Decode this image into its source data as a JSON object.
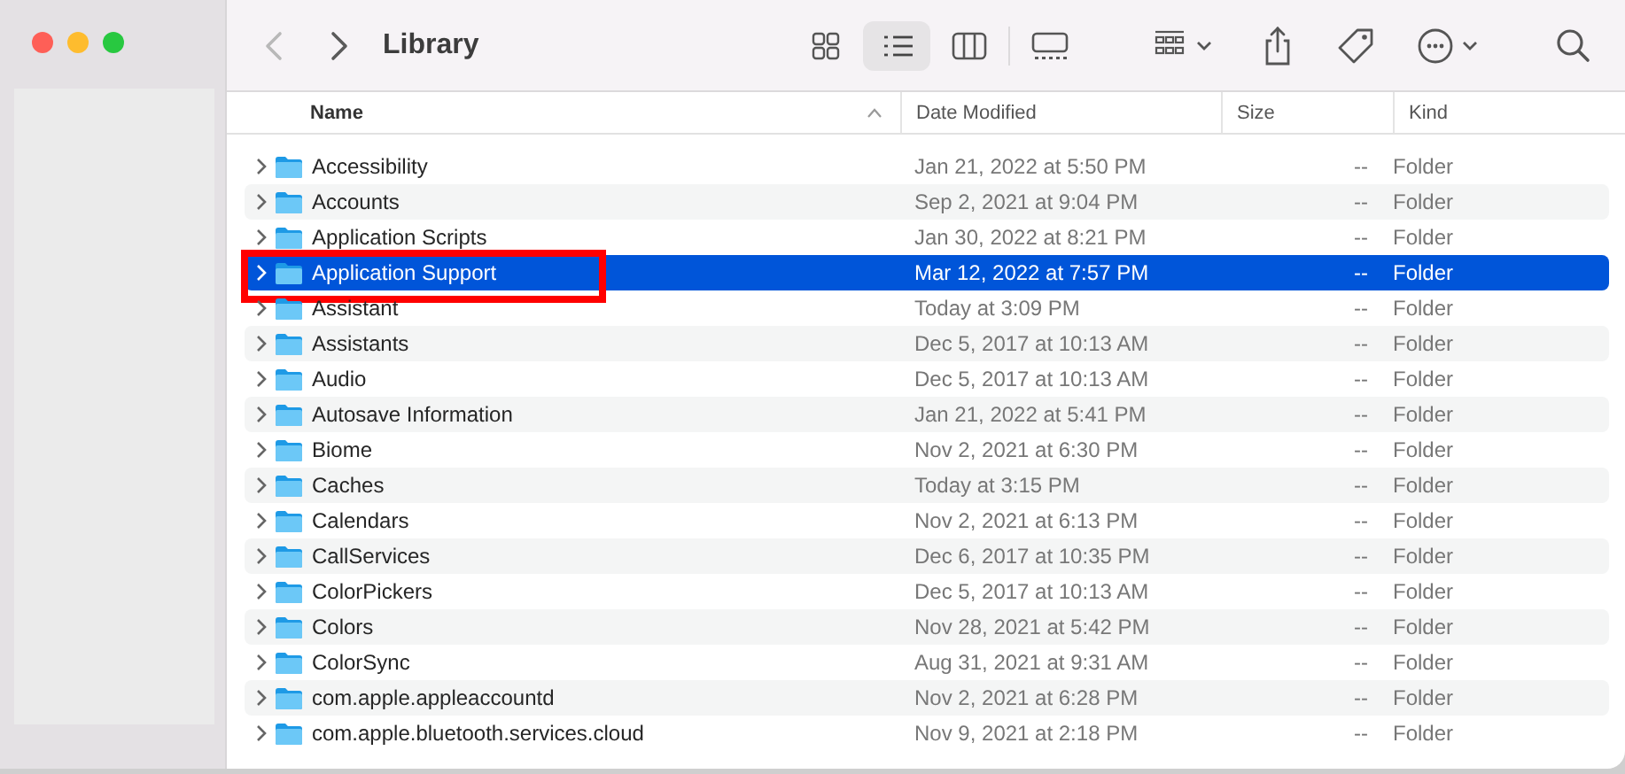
{
  "window": {
    "title": "Library"
  },
  "navigation": {
    "back_disabled": true,
    "forward_disabled": false
  },
  "views": [
    {
      "kind": "icons",
      "selected": false
    },
    {
      "kind": "list",
      "selected": true
    },
    {
      "kind": "columns",
      "selected": false
    },
    {
      "kind": "gallery",
      "selected": false
    }
  ],
  "columns": [
    {
      "label": "Name",
      "sorted": true
    },
    {
      "label": "Date Modified",
      "sorted": false
    },
    {
      "label": "Size",
      "sorted": false
    },
    {
      "label": "Kind",
      "sorted": false
    }
  ],
  "rows": [
    {
      "name": "Accessibility",
      "date": "Jan 21, 2022 at 5:50 PM",
      "size": "--",
      "kind": "Folder",
      "selected": false
    },
    {
      "name": "Accounts",
      "date": "Sep 2, 2021 at 9:04 PM",
      "size": "--",
      "kind": "Folder",
      "selected": false
    },
    {
      "name": "Application Scripts",
      "date": "Jan 30, 2022 at 8:21 PM",
      "size": "--",
      "kind": "Folder",
      "selected": false
    },
    {
      "name": "Application Support",
      "date": "Mar 12, 2022 at 7:57 PM",
      "size": "--",
      "kind": "Folder",
      "selected": true,
      "highlighted": true
    },
    {
      "name": "Assistant",
      "date": "Today at 3:09 PM",
      "size": "--",
      "kind": "Folder",
      "selected": false
    },
    {
      "name": "Assistants",
      "date": "Dec 5, 2017 at 10:13 AM",
      "size": "--",
      "kind": "Folder",
      "selected": false
    },
    {
      "name": "Audio",
      "date": "Dec 5, 2017 at 10:13 AM",
      "size": "--",
      "kind": "Folder",
      "selected": false
    },
    {
      "name": "Autosave Information",
      "date": "Jan 21, 2022 at 5:41 PM",
      "size": "--",
      "kind": "Folder",
      "selected": false
    },
    {
      "name": "Biome",
      "date": "Nov 2, 2021 at 6:30 PM",
      "size": "--",
      "kind": "Folder",
      "selected": false
    },
    {
      "name": "Caches",
      "date": "Today at 3:15 PM",
      "size": "--",
      "kind": "Folder",
      "selected": false
    },
    {
      "name": "Calendars",
      "date": "Nov 2, 2021 at 6:13 PM",
      "size": "--",
      "kind": "Folder",
      "selected": false
    },
    {
      "name": "CallServices",
      "date": "Dec 6, 2017 at 10:35 PM",
      "size": "--",
      "kind": "Folder",
      "selected": false
    },
    {
      "name": "ColorPickers",
      "date": "Dec 5, 2017 at 10:13 AM",
      "size": "--",
      "kind": "Folder",
      "selected": false
    },
    {
      "name": "Colors",
      "date": "Nov 28, 2021 at 5:42 PM",
      "size": "--",
      "kind": "Folder",
      "selected": false
    },
    {
      "name": "ColorSync",
      "date": "Aug 31, 2021 at 9:31 AM",
      "size": "--",
      "kind": "Folder",
      "selected": false
    },
    {
      "name": "com.apple.appleaccountd",
      "date": "Nov 2, 2021 at 6:28 PM",
      "size": "--",
      "kind": "Folder",
      "selected": false
    },
    {
      "name": "com.apple.bluetooth.services.cloud",
      "date": "Nov 9, 2021 at 2:18 PM",
      "size": "--",
      "kind": "Folder",
      "selected": false
    }
  ]
}
